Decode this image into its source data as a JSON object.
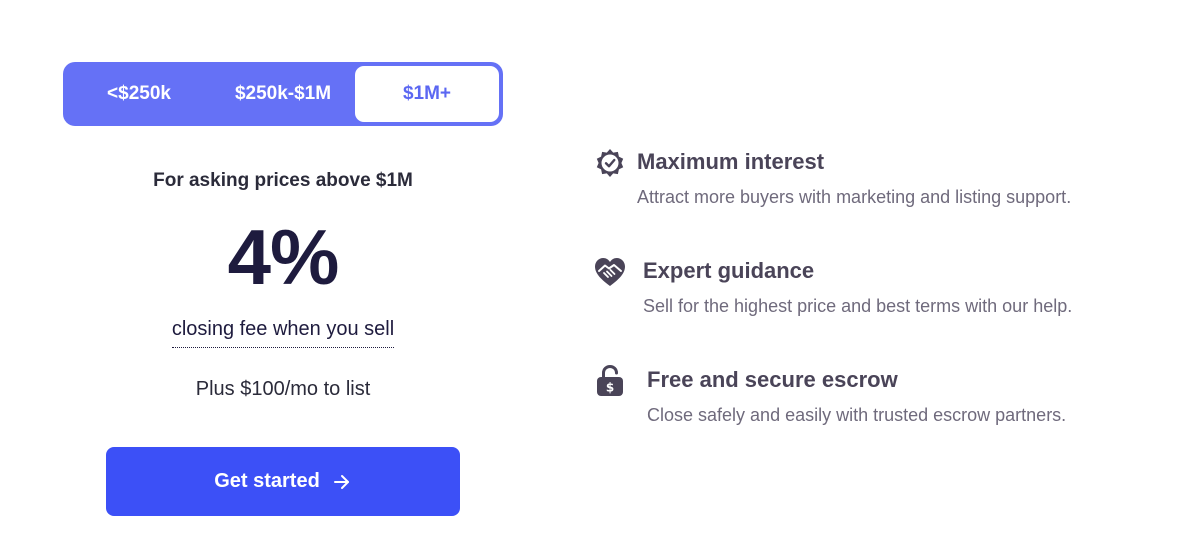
{
  "tiers": {
    "options": [
      "<$250k",
      "$250k-$1M",
      "$1M+"
    ],
    "selected": "$1M+"
  },
  "pricing": {
    "subtitle": "For asking prices above $1M",
    "fee": "4%",
    "fee_note": "closing fee when you sell",
    "list_fee": "Plus $100/mo to list"
  },
  "cta": {
    "label": "Get started",
    "icon": "arrow-right-icon"
  },
  "features": [
    {
      "icon": "verified-badge-icon",
      "title": "Maximum interest",
      "description": "Attract more buyers with marketing and listing support."
    },
    {
      "icon": "handshake-heart-icon",
      "title": "Expert guidance",
      "description": "Sell for the highest price and best terms with our help."
    },
    {
      "icon": "lock-dollar-icon",
      "title": "Free and secure escrow",
      "description": "Close safely and easily with trusted escrow partners."
    }
  ],
  "colors": {
    "tier_bg": "#6571f6",
    "tier_active_text": "#5b67f2",
    "cta_bg": "#3c50f7",
    "fee_text": "#1e1b3e",
    "feature_icon": "#4a4458"
  }
}
